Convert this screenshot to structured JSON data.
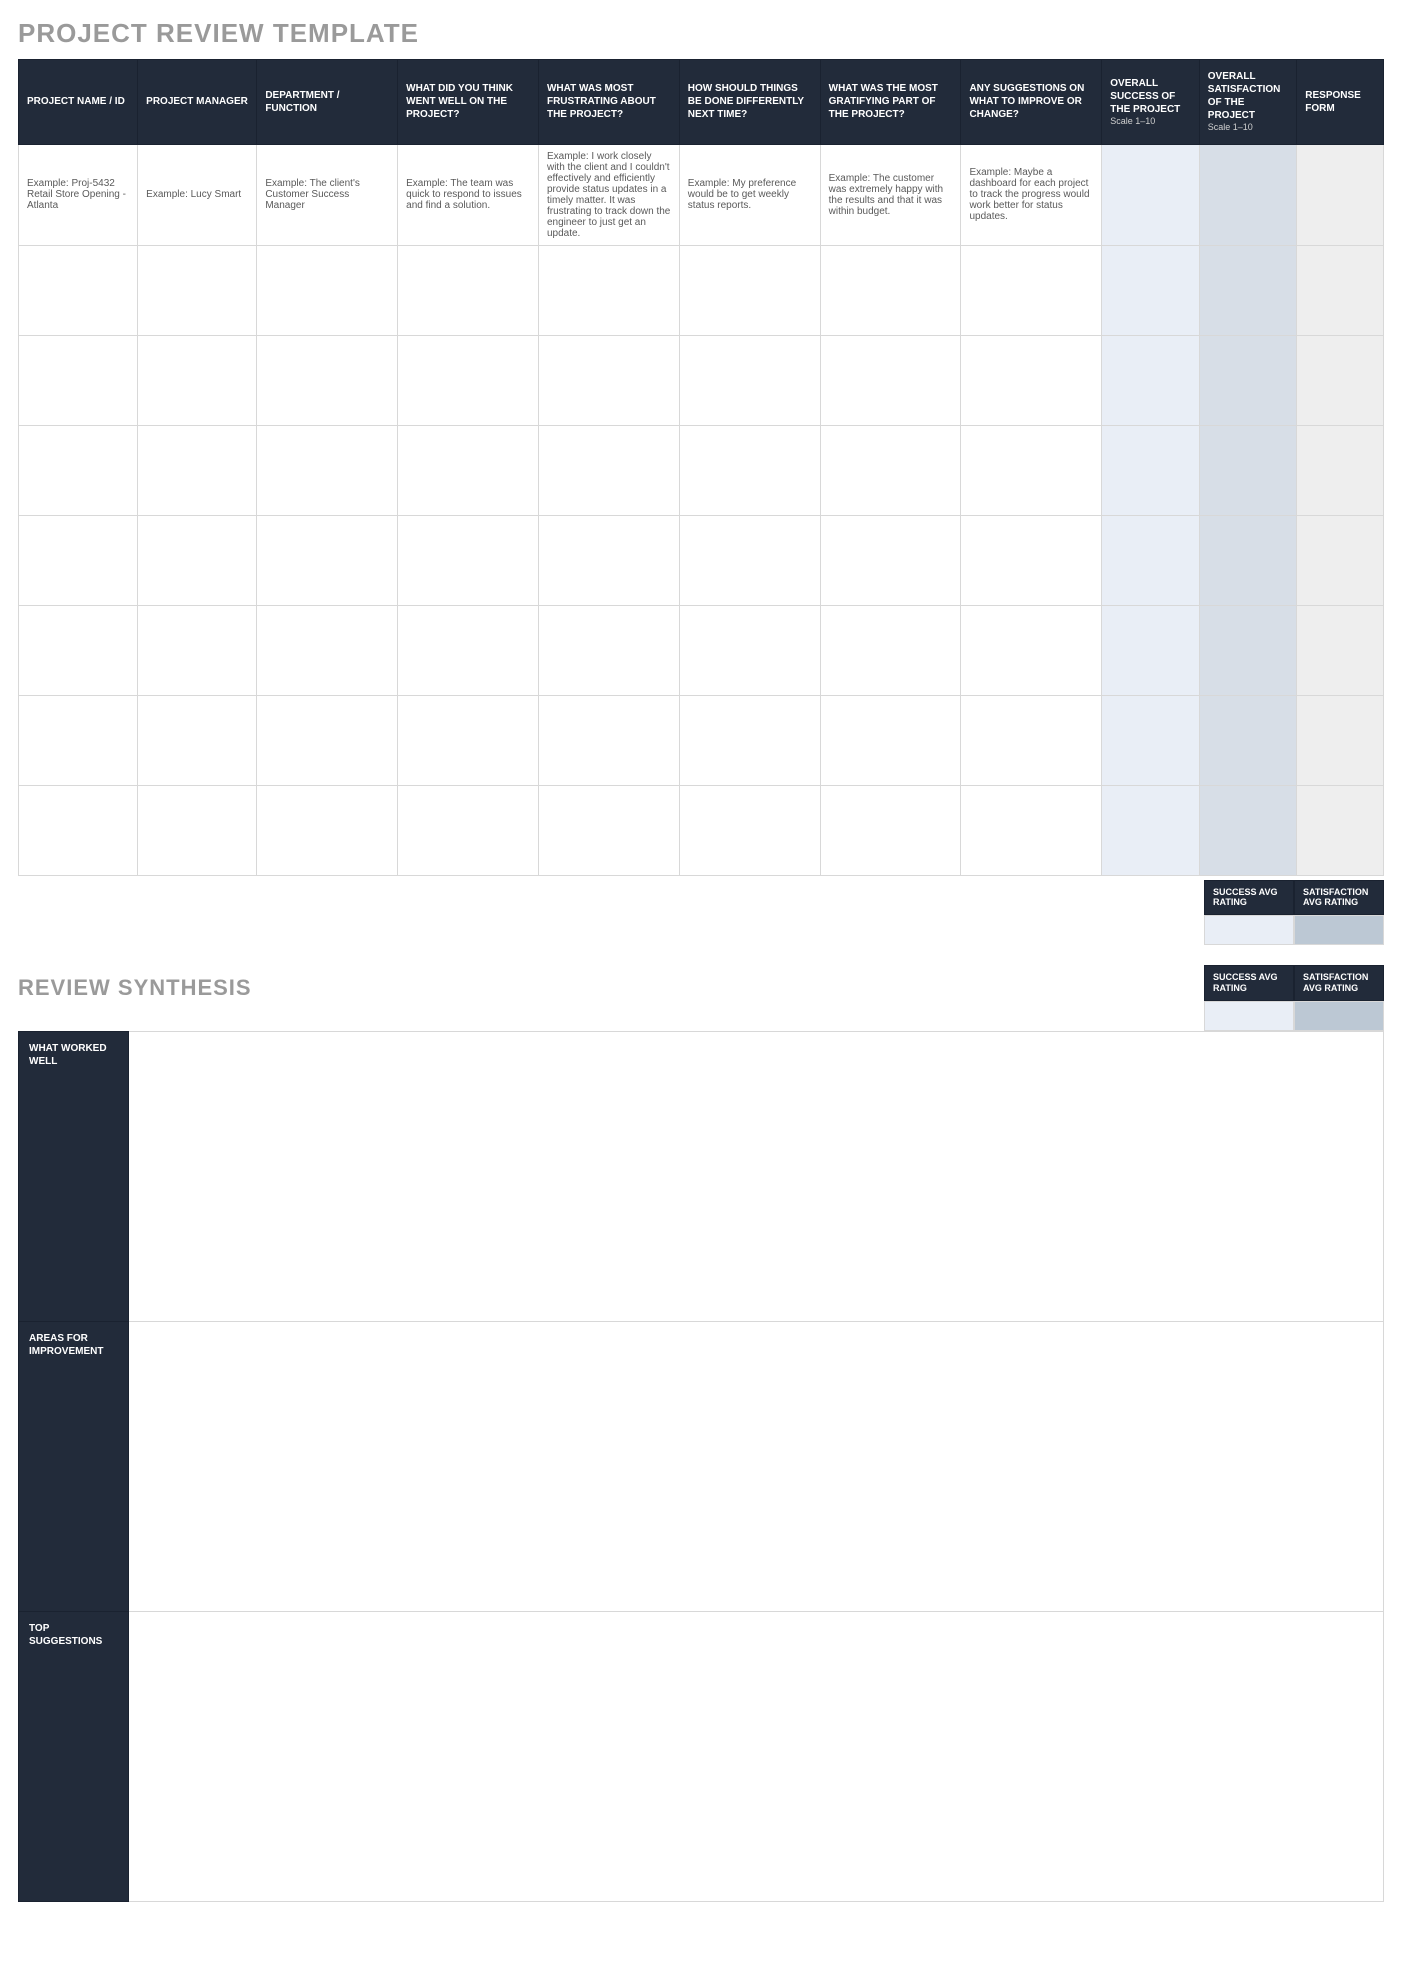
{
  "title": "PROJECT REVIEW TEMPLATE",
  "headers": {
    "c0": "PROJECT NAME / ID",
    "c1": "PROJECT MANAGER",
    "c2": "DEPARTMENT / FUNCTION",
    "c3": "WHAT DID YOU THINK WENT WELL ON THE PROJECT?",
    "c4": "WHAT WAS MOST FRUSTRATING ABOUT THE PROJECT?",
    "c5": "HOW SHOULD THINGS BE DONE DIFFERENTLY NEXT TIME?",
    "c6": "WHAT WAS THE MOST GRATIFYING PART OF THE PROJECT?",
    "c7": "ANY SUGGESTIONS ON WHAT TO IMPROVE OR CHANGE?",
    "c8": "OVERALL SUCCESS OF THE PROJECT",
    "c8_sub": "Scale 1–10",
    "c9": "OVERALL SATISFACTION OF THE PROJECT",
    "c9_sub": "Scale 1–10",
    "c10": "RESPONSE FORM"
  },
  "row1": {
    "c0": "Example: Proj-5432 Retail Store Opening - Atlanta",
    "c1": "Example: Lucy Smart",
    "c2": "Example: The client's Customer Success Manager",
    "c3": "Example: The team was quick to respond to issues and find a solution.",
    "c4": "Example: I work closely with the client and I couldn't effectively and efficiently provide status updates in a timely matter. It was frustrating to track down the engineer to just get an update.",
    "c5": "Example: My preference would be to get weekly status reports.",
    "c6": "Example: The customer was extremely happy with the results and that it was within budget.",
    "c7": "Example: Maybe a dashboard for each project to track the progress would work better for status updates.",
    "c8": "",
    "c9": "",
    "c10": ""
  },
  "avg": {
    "success_label": "SUCCESS AVG RATING",
    "satisfaction_label": "SATISFACTION AVG RATING",
    "success_value": "",
    "satisfaction_value": ""
  },
  "avg2": {
    "success_label": "SUCCESS AVG RATING",
    "satisfaction_label": "SATISFACTION AVG RATING",
    "success_value": "",
    "satisfaction_value": ""
  },
  "synthesis_title": "REVIEW SYNTHESIS",
  "synth": {
    "r0_label": "WHAT WORKED WELL",
    "r0_value": "",
    "r1_label": "AREAS FOR IMPROVEMENT",
    "r1_value": "",
    "r2_label": "TOP SUGGESTIONS",
    "r2_value": ""
  }
}
